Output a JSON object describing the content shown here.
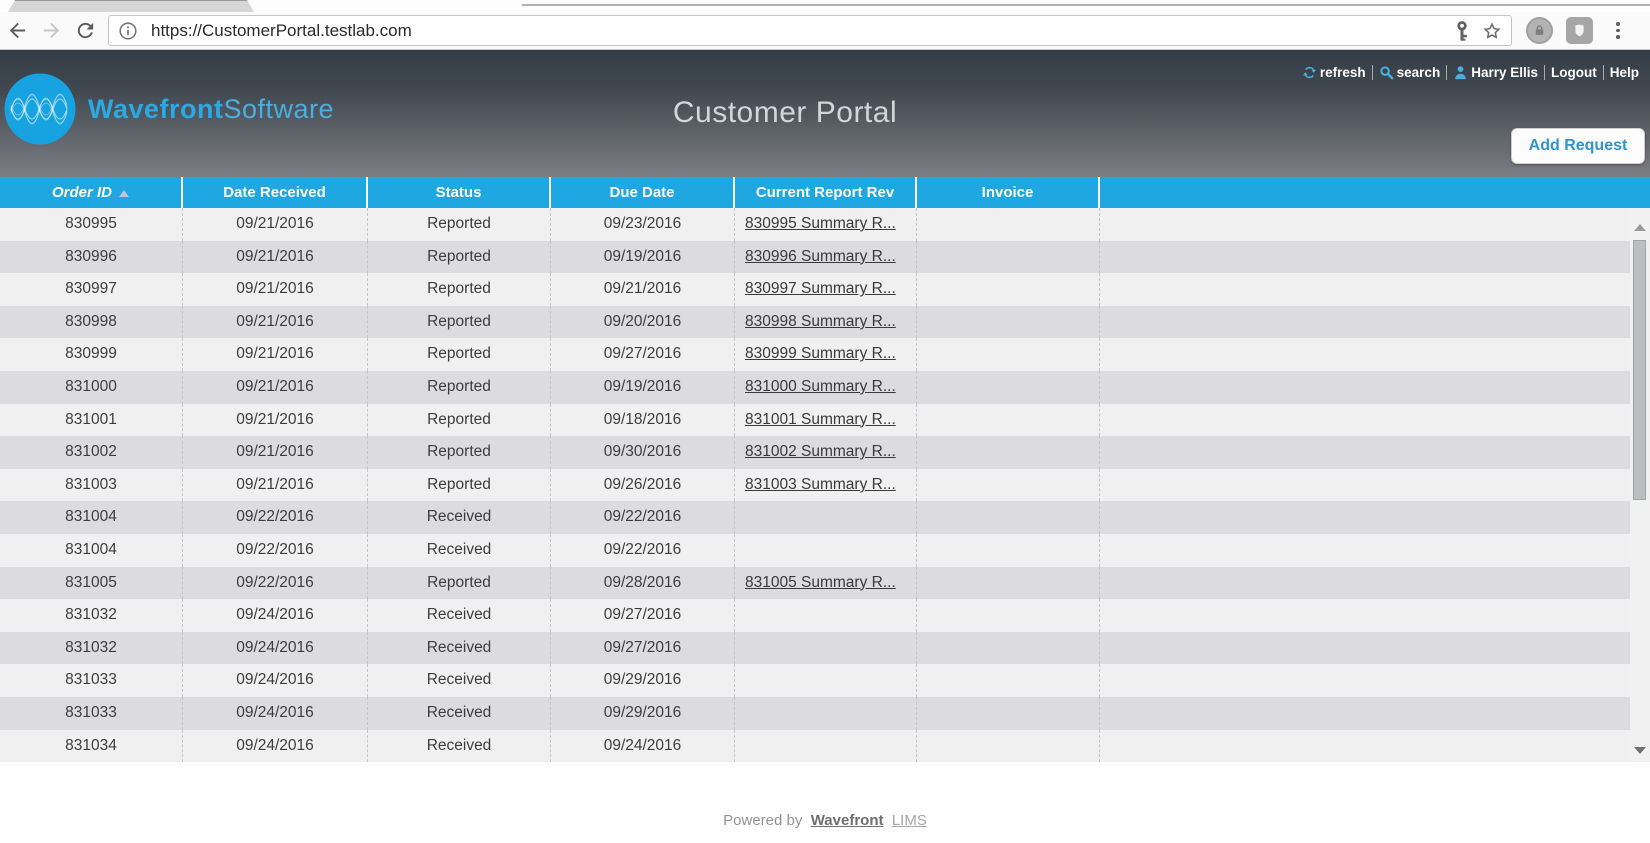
{
  "browser": {
    "url": "https://CustomerPortal.testlab.com"
  },
  "header": {
    "brand": {
      "bold": "Wavefront",
      "light": "Software"
    },
    "title": "Customer Portal",
    "nav": {
      "refresh_label": "refresh",
      "search_label": "search",
      "user_name": "Harry Ellis",
      "logout_label": "Logout",
      "help_label": "Help"
    },
    "add_request_label": "Add Request"
  },
  "table": {
    "columns": [
      "Order ID",
      "Date Received",
      "Status",
      "Due Date",
      "Current Report Rev",
      "Invoice"
    ],
    "sort": {
      "column": "Order ID",
      "direction": "ascending"
    },
    "rows": [
      {
        "order_id": "830995",
        "date_received": "09/21/2016",
        "status": "Reported",
        "due_date": "09/23/2016",
        "report_link": "830995 Summary R...",
        "invoice": ""
      },
      {
        "order_id": "830996",
        "date_received": "09/21/2016",
        "status": "Reported",
        "due_date": "09/19/2016",
        "report_link": "830996 Summary R...",
        "invoice": ""
      },
      {
        "order_id": "830997",
        "date_received": "09/21/2016",
        "status": "Reported",
        "due_date": "09/21/2016",
        "report_link": "830997 Summary R...",
        "invoice": ""
      },
      {
        "order_id": "830998",
        "date_received": "09/21/2016",
        "status": "Reported",
        "due_date": "09/20/2016",
        "report_link": "830998 Summary R...",
        "invoice": ""
      },
      {
        "order_id": "830999",
        "date_received": "09/21/2016",
        "status": "Reported",
        "due_date": "09/27/2016",
        "report_link": "830999 Summary R...",
        "invoice": ""
      },
      {
        "order_id": "831000",
        "date_received": "09/21/2016",
        "status": "Reported",
        "due_date": "09/19/2016",
        "report_link": "831000 Summary R...",
        "invoice": ""
      },
      {
        "order_id": "831001",
        "date_received": "09/21/2016",
        "status": "Reported",
        "due_date": "09/18/2016",
        "report_link": "831001 Summary R...",
        "invoice": ""
      },
      {
        "order_id": "831002",
        "date_received": "09/21/2016",
        "status": "Reported",
        "due_date": "09/30/2016",
        "report_link": "831002 Summary R...",
        "invoice": ""
      },
      {
        "order_id": "831003",
        "date_received": "09/21/2016",
        "status": "Reported",
        "due_date": "09/26/2016",
        "report_link": "831003 Summary R...",
        "invoice": ""
      },
      {
        "order_id": "831004",
        "date_received": "09/22/2016",
        "status": "Received",
        "due_date": "09/22/2016",
        "report_link": "",
        "invoice": ""
      },
      {
        "order_id": "831004",
        "date_received": "09/22/2016",
        "status": "Received",
        "due_date": "09/22/2016",
        "report_link": "",
        "invoice": ""
      },
      {
        "order_id": "831005",
        "date_received": "09/22/2016",
        "status": "Reported",
        "due_date": "09/28/2016",
        "report_link": "831005 Summary R...",
        "invoice": ""
      },
      {
        "order_id": "831032",
        "date_received": "09/24/2016",
        "status": "Received",
        "due_date": "09/27/2016",
        "report_link": "",
        "invoice": ""
      },
      {
        "order_id": "831032",
        "date_received": "09/24/2016",
        "status": "Received",
        "due_date": "09/27/2016",
        "report_link": "",
        "invoice": ""
      },
      {
        "order_id": "831033",
        "date_received": "09/24/2016",
        "status": "Received",
        "due_date": "09/29/2016",
        "report_link": "",
        "invoice": ""
      },
      {
        "order_id": "831033",
        "date_received": "09/24/2016",
        "status": "Received",
        "due_date": "09/29/2016",
        "report_link": "",
        "invoice": ""
      },
      {
        "order_id": "831034",
        "date_received": "09/24/2016",
        "status": "Received",
        "due_date": "09/24/2016",
        "report_link": "",
        "invoice": ""
      }
    ]
  },
  "footer": {
    "powered_by": "Powered by",
    "brand": "Wavefront",
    "product": "LIMS"
  },
  "colors": {
    "table_header_blue": "#1ea7e1",
    "brand_blue": "#2aa9e4",
    "header_gradient_top": "#343d46",
    "header_gradient_bottom": "#7b7e83",
    "row_light": "#f0f0f1",
    "row_dark": "#dcdcde",
    "link_text": "#3a3a3a",
    "button_text_blue": "#2d95d3"
  }
}
